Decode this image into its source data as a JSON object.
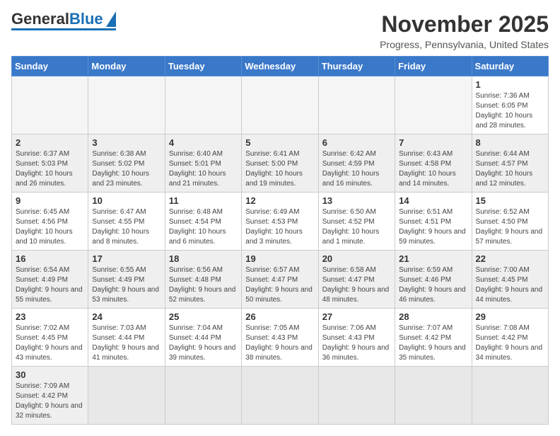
{
  "header": {
    "logo_general": "General",
    "logo_blue": "Blue",
    "title": "November 2025",
    "subtitle": "Progress, Pennsylvania, United States"
  },
  "weekdays": [
    "Sunday",
    "Monday",
    "Tuesday",
    "Wednesday",
    "Thursday",
    "Friday",
    "Saturday"
  ],
  "weeks": [
    [
      {
        "day": "",
        "info": "",
        "empty": true
      },
      {
        "day": "",
        "info": "",
        "empty": true
      },
      {
        "day": "",
        "info": "",
        "empty": true
      },
      {
        "day": "",
        "info": "",
        "empty": true
      },
      {
        "day": "",
        "info": "",
        "empty": true
      },
      {
        "day": "",
        "info": "",
        "empty": true
      },
      {
        "day": "1",
        "info": "Sunrise: 7:36 AM\nSunset: 6:05 PM\nDaylight: 10 hours and 28 minutes.",
        "empty": false
      }
    ],
    [
      {
        "day": "2",
        "info": "Sunrise: 6:37 AM\nSunset: 5:03 PM\nDaylight: 10 hours and 26 minutes.",
        "empty": false
      },
      {
        "day": "3",
        "info": "Sunrise: 6:38 AM\nSunset: 5:02 PM\nDaylight: 10 hours and 23 minutes.",
        "empty": false
      },
      {
        "day": "4",
        "info": "Sunrise: 6:40 AM\nSunset: 5:01 PM\nDaylight: 10 hours and 21 minutes.",
        "empty": false
      },
      {
        "day": "5",
        "info": "Sunrise: 6:41 AM\nSunset: 5:00 PM\nDaylight: 10 hours and 19 minutes.",
        "empty": false
      },
      {
        "day": "6",
        "info": "Sunrise: 6:42 AM\nSunset: 4:59 PM\nDaylight: 10 hours and 16 minutes.",
        "empty": false
      },
      {
        "day": "7",
        "info": "Sunrise: 6:43 AM\nSunset: 4:58 PM\nDaylight: 10 hours and 14 minutes.",
        "empty": false
      },
      {
        "day": "8",
        "info": "Sunrise: 6:44 AM\nSunset: 4:57 PM\nDaylight: 10 hours and 12 minutes.",
        "empty": false
      }
    ],
    [
      {
        "day": "9",
        "info": "Sunrise: 6:45 AM\nSunset: 4:56 PM\nDaylight: 10 hours and 10 minutes.",
        "empty": false
      },
      {
        "day": "10",
        "info": "Sunrise: 6:47 AM\nSunset: 4:55 PM\nDaylight: 10 hours and 8 minutes.",
        "empty": false
      },
      {
        "day": "11",
        "info": "Sunrise: 6:48 AM\nSunset: 4:54 PM\nDaylight: 10 hours and 6 minutes.",
        "empty": false
      },
      {
        "day": "12",
        "info": "Sunrise: 6:49 AM\nSunset: 4:53 PM\nDaylight: 10 hours and 3 minutes.",
        "empty": false
      },
      {
        "day": "13",
        "info": "Sunrise: 6:50 AM\nSunset: 4:52 PM\nDaylight: 10 hours and 1 minute.",
        "empty": false
      },
      {
        "day": "14",
        "info": "Sunrise: 6:51 AM\nSunset: 4:51 PM\nDaylight: 9 hours and 59 minutes.",
        "empty": false
      },
      {
        "day": "15",
        "info": "Sunrise: 6:52 AM\nSunset: 4:50 PM\nDaylight: 9 hours and 57 minutes.",
        "empty": false
      }
    ],
    [
      {
        "day": "16",
        "info": "Sunrise: 6:54 AM\nSunset: 4:49 PM\nDaylight: 9 hours and 55 minutes.",
        "empty": false
      },
      {
        "day": "17",
        "info": "Sunrise: 6:55 AM\nSunset: 4:49 PM\nDaylight: 9 hours and 53 minutes.",
        "empty": false
      },
      {
        "day": "18",
        "info": "Sunrise: 6:56 AM\nSunset: 4:48 PM\nDaylight: 9 hours and 52 minutes.",
        "empty": false
      },
      {
        "day": "19",
        "info": "Sunrise: 6:57 AM\nSunset: 4:47 PM\nDaylight: 9 hours and 50 minutes.",
        "empty": false
      },
      {
        "day": "20",
        "info": "Sunrise: 6:58 AM\nSunset: 4:47 PM\nDaylight: 9 hours and 48 minutes.",
        "empty": false
      },
      {
        "day": "21",
        "info": "Sunrise: 6:59 AM\nSunset: 4:46 PM\nDaylight: 9 hours and 46 minutes.",
        "empty": false
      },
      {
        "day": "22",
        "info": "Sunrise: 7:00 AM\nSunset: 4:45 PM\nDaylight: 9 hours and 44 minutes.",
        "empty": false
      }
    ],
    [
      {
        "day": "23",
        "info": "Sunrise: 7:02 AM\nSunset: 4:45 PM\nDaylight: 9 hours and 43 minutes.",
        "empty": false
      },
      {
        "day": "24",
        "info": "Sunrise: 7:03 AM\nSunset: 4:44 PM\nDaylight: 9 hours and 41 minutes.",
        "empty": false
      },
      {
        "day": "25",
        "info": "Sunrise: 7:04 AM\nSunset: 4:44 PM\nDaylight: 9 hours and 39 minutes.",
        "empty": false
      },
      {
        "day": "26",
        "info": "Sunrise: 7:05 AM\nSunset: 4:43 PM\nDaylight: 9 hours and 38 minutes.",
        "empty": false
      },
      {
        "day": "27",
        "info": "Sunrise: 7:06 AM\nSunset: 4:43 PM\nDaylight: 9 hours and 36 minutes.",
        "empty": false
      },
      {
        "day": "28",
        "info": "Sunrise: 7:07 AM\nSunset: 4:42 PM\nDaylight: 9 hours and 35 minutes.",
        "empty": false
      },
      {
        "day": "29",
        "info": "Sunrise: 7:08 AM\nSunset: 4:42 PM\nDaylight: 9 hours and 34 minutes.",
        "empty": false
      }
    ],
    [
      {
        "day": "30",
        "info": "Sunrise: 7:09 AM\nSunset: 4:42 PM\nDaylight: 9 hours and 32 minutes.",
        "empty": false
      },
      {
        "day": "",
        "info": "",
        "empty": true
      },
      {
        "day": "",
        "info": "",
        "empty": true
      },
      {
        "day": "",
        "info": "",
        "empty": true
      },
      {
        "day": "",
        "info": "",
        "empty": true
      },
      {
        "day": "",
        "info": "",
        "empty": true
      },
      {
        "day": "",
        "info": "",
        "empty": true
      }
    ]
  ]
}
